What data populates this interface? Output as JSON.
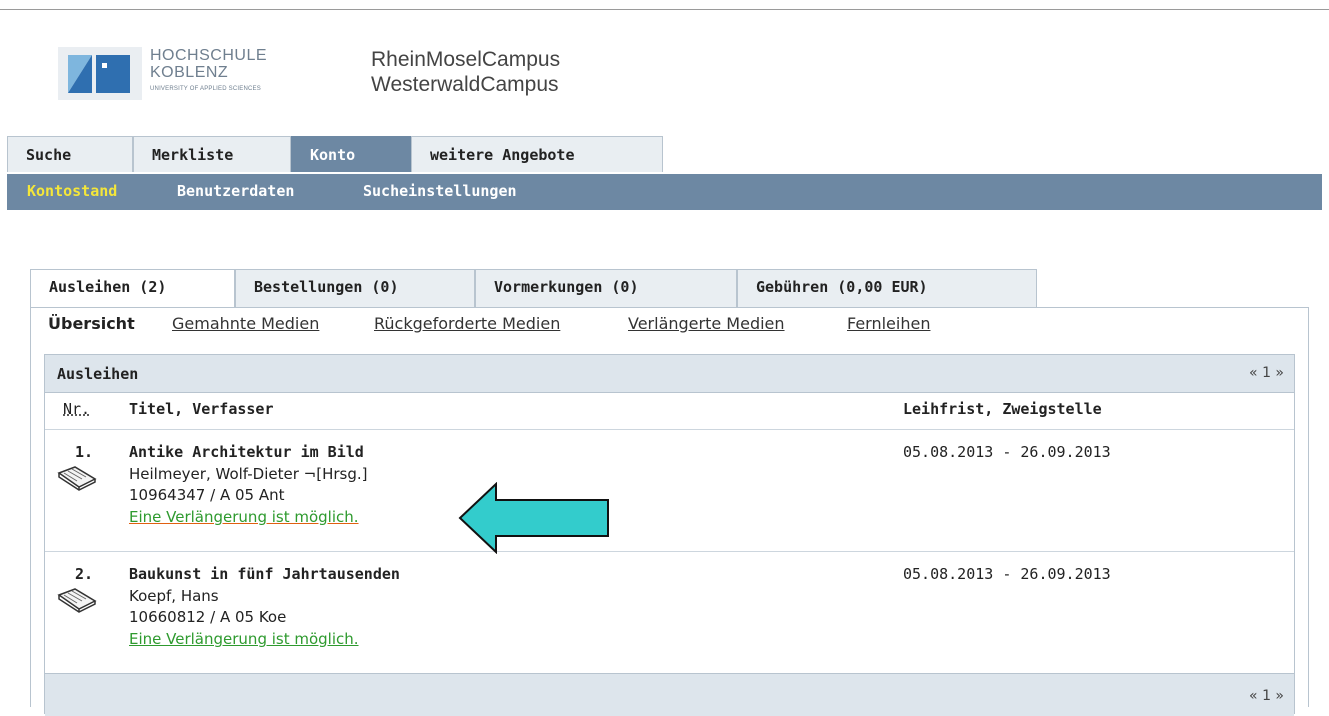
{
  "header": {
    "logo_line1": "HOCHSCHULE",
    "logo_line2": "KOBLENZ",
    "logo_line3": "UNIVERSITY OF APPLIED SCIENCES",
    "campus_line1": "RheinMoselCampus",
    "campus_line2": "WesterwaldCampus"
  },
  "main_tabs": [
    {
      "label": "Suche",
      "active": false
    },
    {
      "label": "Merkliste",
      "active": false
    },
    {
      "label": "Konto",
      "active": true
    },
    {
      "label": "weitere Angebote",
      "active": false
    }
  ],
  "sub_nav": [
    {
      "label": "Kontostand",
      "active": true
    },
    {
      "label": "Benutzerdaten",
      "active": false
    },
    {
      "label": "Sucheinstellungen",
      "active": false
    }
  ],
  "account_tabs": [
    {
      "label": "Ausleihen (2)",
      "active": true
    },
    {
      "label": "Bestellungen (0)",
      "active": false
    },
    {
      "label": "Vormerkungen (0)",
      "active": false
    },
    {
      "label": "Gebühren  (0,00 EUR)",
      "active": false
    }
  ],
  "account_links": {
    "current": "Übersicht",
    "links": [
      "Gemahnte Medien",
      "Rückgeforderte Medien",
      "Verlängerte Medien",
      "Fernleihen"
    ]
  },
  "loans_table": {
    "title": "Ausleihen",
    "pager": "« 1 »",
    "col_nr": "Nr.",
    "col_title": "Titel, Verfasser",
    "col_due": "Leihfrist, Zweigstelle",
    "rows": [
      {
        "num": "1.",
        "title": "Antike Architektur im Bild",
        "author": "Heilmeyer, Wolf-Dieter ¬[Hrsg.]",
        "signature": "10964347  / A 05 Ant",
        "renew": "Eine Verlängerung ist möglich.",
        "due": "05.08.2013 - 26.09.2013"
      },
      {
        "num": "2.",
        "title": "Baukunst in fünf Jahrtausenden",
        "author": "Koepf, Hans",
        "signature": "10660812  / A 05 Koe",
        "renew": "Eine Verlängerung ist möglich.",
        "due": "05.08.2013 - 26.09.2013"
      }
    ],
    "footer_pager": "« 1 »"
  },
  "colors": {
    "nav_bar": "#6d88a3",
    "active_subnav": "#f4e63a",
    "renew_link": "#2e9a2e",
    "arrow_fill": "#33cccc"
  }
}
